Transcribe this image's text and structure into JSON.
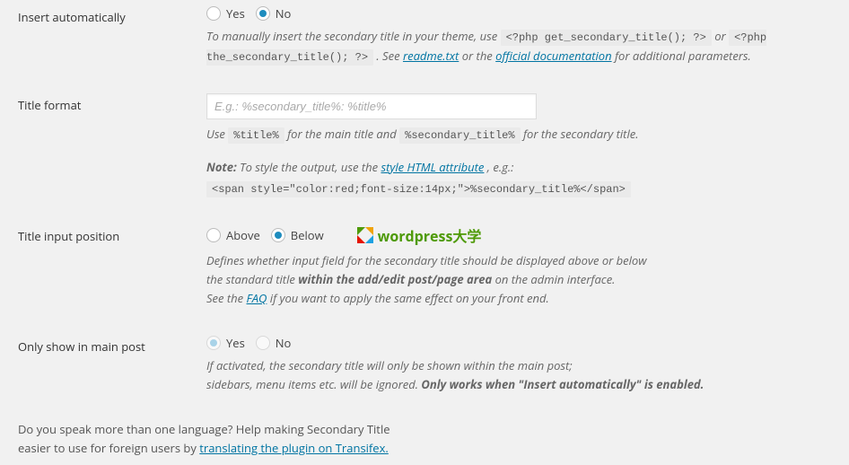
{
  "rows": {
    "insert": {
      "label": "Insert automatically",
      "yes": "Yes",
      "no": "No",
      "desc1": "To manually insert the secondary title in your theme, use ",
      "code1": "<?php get_secondary_title(); ?>",
      "or": " or ",
      "code2": "<?php the_secondary_title(); ?>",
      "see": ". See ",
      "readme": "readme.txt",
      "or2": " or the ",
      "docs": "official documentation",
      "desc2": " for additional parameters."
    },
    "format": {
      "label": "Title format",
      "placeholder": "E.g.: %secondary_title%: %title%",
      "value": "",
      "use": "Use ",
      "code1": "%title%",
      "mid": " for the main title and ",
      "code2": "%secondary_title%",
      "end": " for the secondary title.",
      "note": "Note:",
      "note_text": " To style the output, use the ",
      "style_link": "style HTML attribute",
      "note_end": ", e.g.:",
      "example": "<span style=\"color:red;font-size:14px;\">%secondary_title%</span>"
    },
    "position": {
      "label": "Title input position",
      "above": "Above",
      "below": "Below",
      "watermark": "wordpress大学",
      "d1a": "Defines whether input field for the secondary title should be displayed above or below",
      "d2a": "the standard title ",
      "d2b": "within the add/edit post/page area",
      "d2c": " on the admin interface.",
      "d3a": "See the ",
      "faq": "FAQ",
      "d3b": " if you want to apply the same effect on your front end."
    },
    "mainpost": {
      "label": "Only show in main post",
      "yes": "Yes",
      "no": "No",
      "d1": "If activated, the secondary title will only be shown within the main post;",
      "d2a": "sidebars, menu items etc. will be ignored. ",
      "d2b": "Only works when \"Insert automatically\" is enabled."
    }
  },
  "footer": {
    "l1": "Do you speak more than one language? Help making Secondary Title",
    "l2a": "easier to use for foreign users by ",
    "link": "translating the plugin on Transifex."
  }
}
